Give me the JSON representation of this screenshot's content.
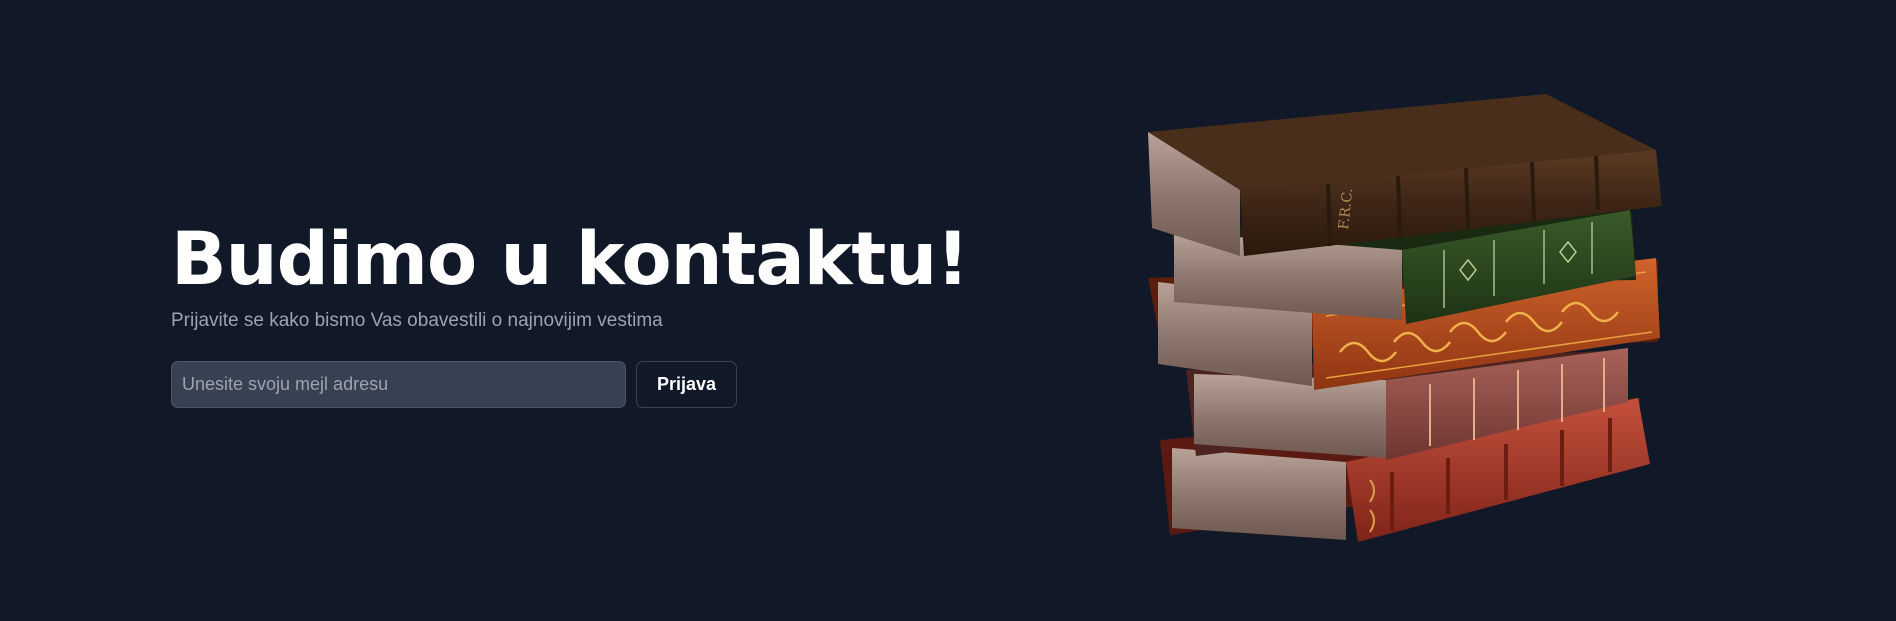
{
  "hero": {
    "title": "Budimo u kontaktu!",
    "subtitle": "Prijavite se kako bismo Vas obavestili o najnovijim vestima"
  },
  "signup": {
    "email_placeholder": "Unesite svoju mejl adresu",
    "email_value": "",
    "submit_label": "Prijava"
  },
  "image": {
    "name": "stack-of-books-illustration",
    "spine_text": "F.R.C."
  },
  "colors": {
    "background": "#111827",
    "title": "#ffffff",
    "subtitle": "#9ca3af",
    "input_background": "#374151",
    "button_border": "#374151"
  }
}
